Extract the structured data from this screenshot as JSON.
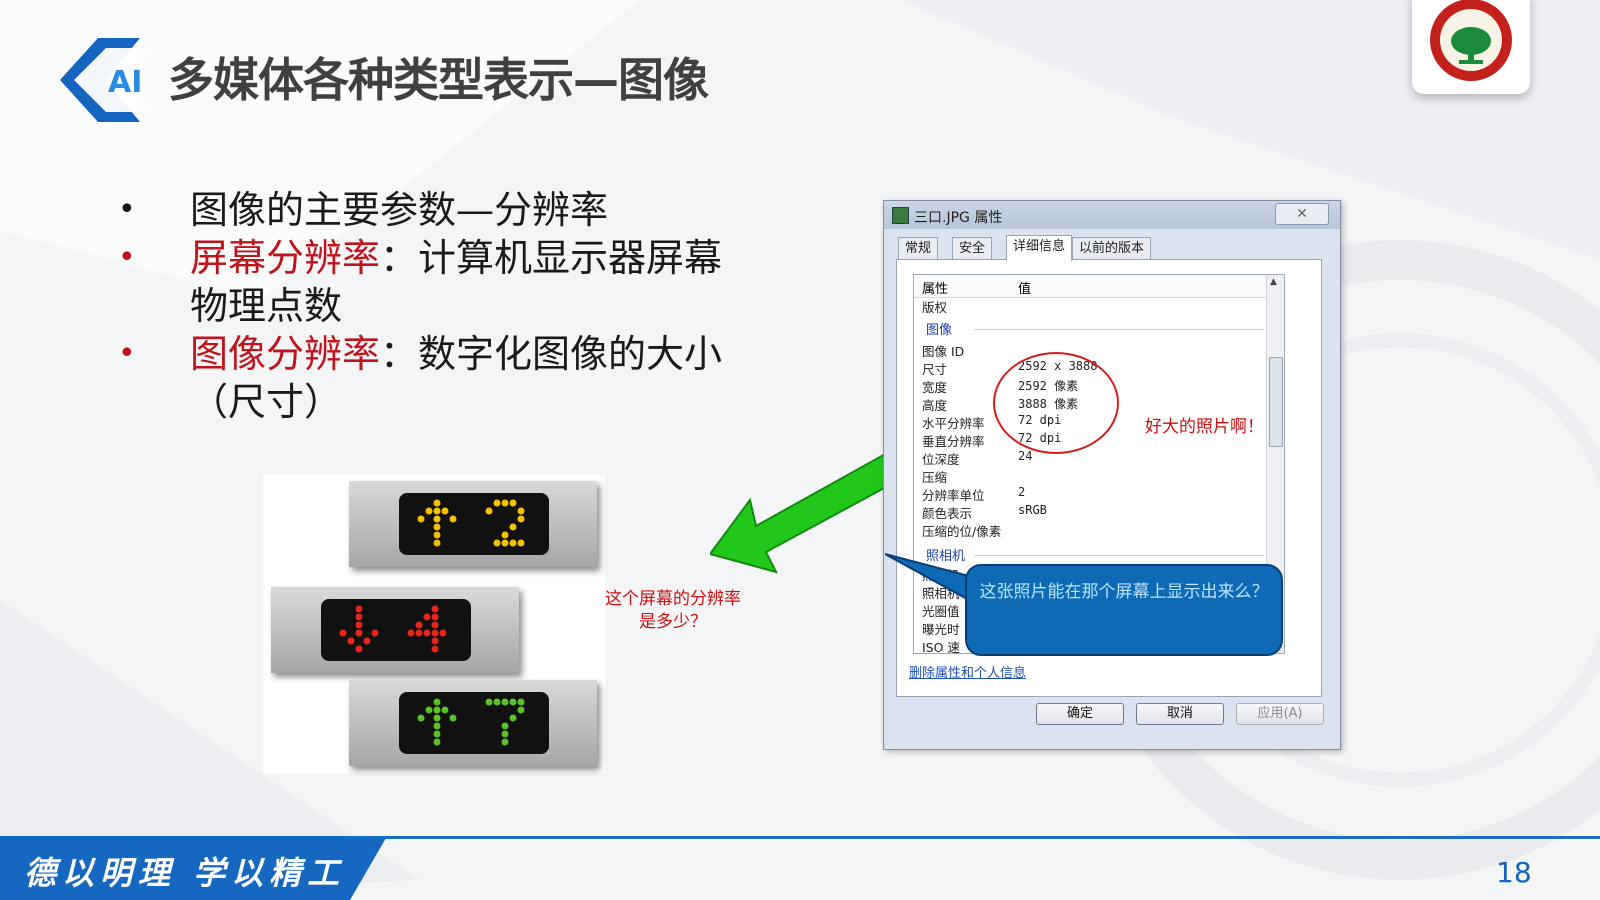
{
  "header": {
    "logo_text": "AI",
    "title": "多媒体各种类型表示—图像"
  },
  "bullets": [
    {
      "term": "",
      "text": "图像的主要参数—分辨率",
      "dot_color": "#111111"
    },
    {
      "term": "屏幕分辨率",
      "text": "：计算机显示器屏幕物理点数",
      "dot_color": "#c0141c"
    },
    {
      "term": "图像分辨率",
      "text": "：数字化图像的大小（尺寸）",
      "dot_color": "#c0141c"
    }
  ],
  "elevator_image": {
    "panels": [
      {
        "arrow": "↑",
        "number": "2",
        "led_color": "#f2c200"
      },
      {
        "arrow": "↓",
        "number": "4",
        "led_color": "#e8241b"
      },
      {
        "arrow": "↑",
        "number": "7",
        "led_color": "#5cc227"
      }
    ]
  },
  "screen_question": "这个屏幕的分辨率是多少？",
  "dialog": {
    "title": "三口.JPG 属性",
    "close_label": "✕",
    "tabs": [
      "常规",
      "安全",
      "详细信息",
      "以前的版本"
    ],
    "active_tab": "详细信息",
    "columns": {
      "property": "属性",
      "value": "值"
    },
    "rows_top": [
      {
        "k": "版权",
        "v": ""
      }
    ],
    "section_image": "图像",
    "rows_image": [
      {
        "k": "图像 ID",
        "v": ""
      },
      {
        "k": "尺寸",
        "v": "2592 x 3888"
      },
      {
        "k": "宽度",
        "v": "2592 像素"
      },
      {
        "k": "高度",
        "v": "3888 像素"
      },
      {
        "k": "水平分辨率",
        "v": "72 dpi"
      },
      {
        "k": "垂直分辨率",
        "v": "72 dpi"
      },
      {
        "k": "位深度",
        "v": "24"
      },
      {
        "k": "压缩",
        "v": ""
      },
      {
        "k": "分辨率单位",
        "v": "2"
      },
      {
        "k": "颜色表示",
        "v": "sRGB"
      },
      {
        "k": "压缩的位/像素",
        "v": ""
      }
    ],
    "section_camera": "照相机",
    "rows_camera_partial": [
      "照相机",
      "照相机",
      "光圈值",
      "曝光时",
      "ISO 速"
    ],
    "remove_link": "删除属性和个人信息",
    "buttons": {
      "ok": "确定",
      "cancel": "取消",
      "apply": "应用(A)"
    }
  },
  "big_photo_note": "好大的照片啊！",
  "callout_text": "这张照片能在那个屏幕上显示出来么？",
  "footer": {
    "motto": "德以明理  学以精工",
    "page_number": "18"
  },
  "colors": {
    "accent_blue": "#1570c4",
    "emphasis_red": "#c0141c",
    "arrow_green": "#22c71b"
  }
}
